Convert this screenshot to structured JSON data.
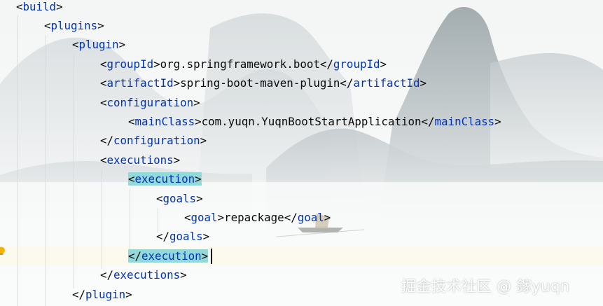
{
  "editor": {
    "lines": [
      {
        "indent": 0,
        "tag": "build",
        "closing": false
      },
      {
        "indent": 1,
        "tag": "plugins",
        "closing": false
      },
      {
        "indent": 2,
        "tag": "plugin",
        "closing": false
      },
      {
        "indent": 3,
        "tag": "groupId",
        "value": "org.springframework.boot"
      },
      {
        "indent": 3,
        "tag": "artifactId",
        "value": "spring-boot-maven-plugin"
      },
      {
        "indent": 3,
        "tag": "configuration",
        "closing": false
      },
      {
        "indent": 4,
        "tag": "mainClass",
        "value": "com.yuqn.YuqnBootStartApplication"
      },
      {
        "indent": 3,
        "tag": "configuration",
        "closing": true
      },
      {
        "indent": 3,
        "tag": "executions",
        "closing": false
      },
      {
        "indent": 4,
        "tag": "execution",
        "closing": false,
        "highlight": true
      },
      {
        "indent": 5,
        "tag": "goals",
        "closing": false
      },
      {
        "indent": 6,
        "tag": "goal",
        "value": "repackage"
      },
      {
        "indent": 5,
        "tag": "goals",
        "closing": true
      },
      {
        "indent": 4,
        "tag": "execution",
        "closing": true,
        "highlight": true,
        "caret": true
      },
      {
        "indent": 3,
        "tag": "executions",
        "closing": true
      },
      {
        "indent": 2,
        "tag": "plugin",
        "closing": true
      }
    ],
    "colors": {
      "tag": "#0033b3",
      "bracket": "#080808",
      "text": "#080808",
      "match_highlight": "#93d9d9",
      "caret_line": "#fcfaed"
    }
  },
  "gutter": {
    "icon": "lightbulb-icon",
    "color": "#f4b400"
  },
  "watermark": {
    "text": "掘金技术社区 @ 鎵yuqn"
  }
}
